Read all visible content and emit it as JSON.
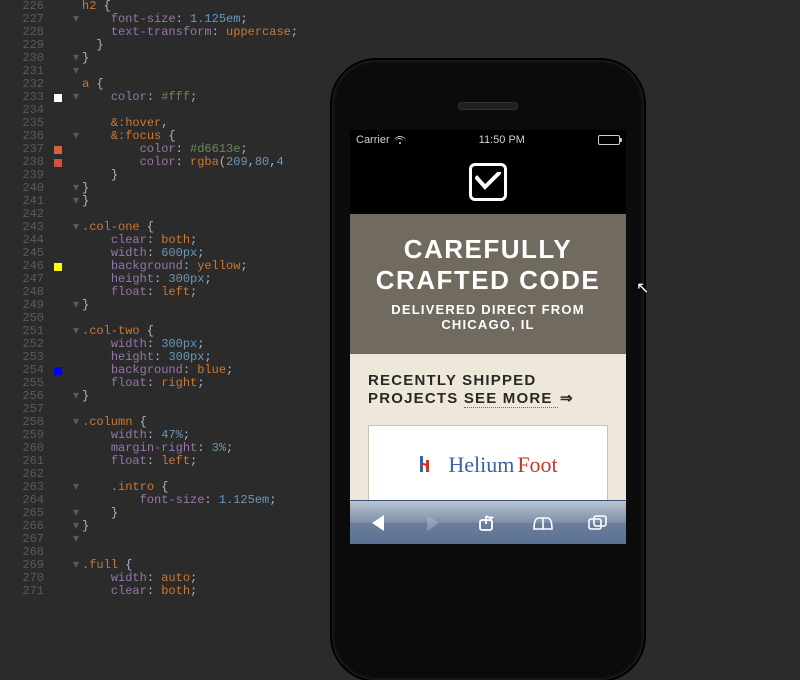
{
  "editor": {
    "first_line": 226,
    "markers": [
      {
        "line": 233,
        "color": "#ffffff"
      },
      {
        "line": 237,
        "color": "#d6613e"
      },
      {
        "line": 238,
        "color": "#d15040"
      },
      {
        "line": 246,
        "color": "#ffff00"
      },
      {
        "line": 254,
        "color": "#0000ff"
      }
    ],
    "fold_lines": [
      227,
      230,
      231,
      233,
      236,
      240,
      241,
      243,
      249,
      251,
      256,
      258,
      263,
      265,
      266,
      267,
      269
    ],
    "lines": [
      [
        {
          "t": "sel",
          "s": "h2"
        },
        {
          "t": "punc",
          "s": " {"
        }
      ],
      [
        {
          "t": "pad",
          "s": "    "
        },
        {
          "t": "prop",
          "s": "font-size"
        },
        {
          "t": "punc",
          "s": ": "
        },
        {
          "t": "val",
          "s": "1.125em"
        },
        {
          "t": "punc",
          "s": ";"
        }
      ],
      [
        {
          "t": "pad",
          "s": "    "
        },
        {
          "t": "prop",
          "s": "text-transform"
        },
        {
          "t": "punc",
          "s": ": "
        },
        {
          "t": "kw",
          "s": "uppercase"
        },
        {
          "t": "punc",
          "s": ";"
        }
      ],
      [
        {
          "t": "pad",
          "s": "  "
        },
        {
          "t": "punc",
          "s": "}"
        }
      ],
      [
        {
          "t": "punc",
          "s": "}"
        }
      ],
      [],
      [
        {
          "t": "sel",
          "s": "a"
        },
        {
          "t": "punc",
          "s": " {"
        }
      ],
      [
        {
          "t": "pad",
          "s": "    "
        },
        {
          "t": "prop",
          "s": "color"
        },
        {
          "t": "punc",
          "s": ": "
        },
        {
          "t": "hex",
          "s": "#fff"
        },
        {
          "t": "punc",
          "s": ";"
        }
      ],
      [],
      [
        {
          "t": "pad",
          "s": "    "
        },
        {
          "t": "sel",
          "s": "&:hover"
        },
        {
          "t": "punc",
          "s": ","
        }
      ],
      [
        {
          "t": "pad",
          "s": "    "
        },
        {
          "t": "sel",
          "s": "&:focus"
        },
        {
          "t": "punc",
          "s": " {"
        }
      ],
      [
        {
          "t": "pad",
          "s": "        "
        },
        {
          "t": "prop",
          "s": "color"
        },
        {
          "t": "punc",
          "s": ": "
        },
        {
          "t": "hex",
          "s": "#d6613e"
        },
        {
          "t": "punc",
          "s": ";"
        }
      ],
      [
        {
          "t": "pad",
          "s": "        "
        },
        {
          "t": "prop",
          "s": "color"
        },
        {
          "t": "punc",
          "s": ": "
        },
        {
          "t": "kw",
          "s": "rgba"
        },
        {
          "t": "punc",
          "s": "("
        },
        {
          "t": "num",
          "s": "209"
        },
        {
          "t": "punc",
          "s": ","
        },
        {
          "t": "num",
          "s": "80"
        },
        {
          "t": "punc",
          "s": ","
        },
        {
          "t": "num",
          "s": "4"
        }
      ],
      [
        {
          "t": "pad",
          "s": "    "
        },
        {
          "t": "punc",
          "s": "}"
        }
      ],
      [
        {
          "t": "punc",
          "s": "}"
        }
      ],
      [
        {
          "t": "punc",
          "s": "}"
        }
      ],
      [],
      [
        {
          "t": "sel",
          "s": ".col-one"
        },
        {
          "t": "punc",
          "s": " {"
        }
      ],
      [
        {
          "t": "pad",
          "s": "    "
        },
        {
          "t": "prop",
          "s": "clear"
        },
        {
          "t": "punc",
          "s": ": "
        },
        {
          "t": "kw",
          "s": "both"
        },
        {
          "t": "punc",
          "s": ";"
        }
      ],
      [
        {
          "t": "pad",
          "s": "    "
        },
        {
          "t": "prop",
          "s": "width"
        },
        {
          "t": "punc",
          "s": ": "
        },
        {
          "t": "val",
          "s": "600px"
        },
        {
          "t": "punc",
          "s": ";"
        }
      ],
      [
        {
          "t": "pad",
          "s": "    "
        },
        {
          "t": "prop",
          "s": "background"
        },
        {
          "t": "punc",
          "s": ": "
        },
        {
          "t": "kw",
          "s": "yellow"
        },
        {
          "t": "punc",
          "s": ";"
        }
      ],
      [
        {
          "t": "pad",
          "s": "    "
        },
        {
          "t": "prop",
          "s": "height"
        },
        {
          "t": "punc",
          "s": ": "
        },
        {
          "t": "val",
          "s": "300px"
        },
        {
          "t": "punc",
          "s": ";"
        }
      ],
      [
        {
          "t": "pad",
          "s": "    "
        },
        {
          "t": "prop",
          "s": "float"
        },
        {
          "t": "punc",
          "s": ": "
        },
        {
          "t": "kw",
          "s": "left"
        },
        {
          "t": "punc",
          "s": ";"
        }
      ],
      [
        {
          "t": "punc",
          "s": "}"
        }
      ],
      [],
      [
        {
          "t": "sel",
          "s": ".col-two"
        },
        {
          "t": "punc",
          "s": " {"
        }
      ],
      [
        {
          "t": "pad",
          "s": "    "
        },
        {
          "t": "prop",
          "s": "width"
        },
        {
          "t": "punc",
          "s": ": "
        },
        {
          "t": "val",
          "s": "300px"
        },
        {
          "t": "punc",
          "s": ";"
        }
      ],
      [
        {
          "t": "pad",
          "s": "    "
        },
        {
          "t": "prop",
          "s": "height"
        },
        {
          "t": "punc",
          "s": ": "
        },
        {
          "t": "val",
          "s": "300px"
        },
        {
          "t": "punc",
          "s": ";"
        }
      ],
      [
        {
          "t": "pad",
          "s": "    "
        },
        {
          "t": "prop",
          "s": "background"
        },
        {
          "t": "punc",
          "s": ": "
        },
        {
          "t": "kw",
          "s": "blue"
        },
        {
          "t": "punc",
          "s": ";"
        }
      ],
      [
        {
          "t": "pad",
          "s": "    "
        },
        {
          "t": "prop",
          "s": "float"
        },
        {
          "t": "punc",
          "s": ": "
        },
        {
          "t": "kw",
          "s": "right"
        },
        {
          "t": "punc",
          "s": ";"
        }
      ],
      [
        {
          "t": "punc",
          "s": "}"
        }
      ],
      [],
      [
        {
          "t": "sel",
          "s": ".column"
        },
        {
          "t": "punc",
          "s": " {"
        }
      ],
      [
        {
          "t": "pad",
          "s": "    "
        },
        {
          "t": "prop",
          "s": "width"
        },
        {
          "t": "punc",
          "s": ": "
        },
        {
          "t": "val",
          "s": "47%"
        },
        {
          "t": "punc",
          "s": ";"
        }
      ],
      [
        {
          "t": "pad",
          "s": "    "
        },
        {
          "t": "prop",
          "s": "margin-right"
        },
        {
          "t": "punc",
          "s": ": "
        },
        {
          "t": "val",
          "s": "3%"
        },
        {
          "t": "punc",
          "s": ";"
        }
      ],
      [
        {
          "t": "pad",
          "s": "    "
        },
        {
          "t": "prop",
          "s": "float"
        },
        {
          "t": "punc",
          "s": ": "
        },
        {
          "t": "kw",
          "s": "left"
        },
        {
          "t": "punc",
          "s": ";"
        }
      ],
      [],
      [
        {
          "t": "pad",
          "s": "    "
        },
        {
          "t": "sel",
          "s": ".intro"
        },
        {
          "t": "punc",
          "s": " {"
        }
      ],
      [
        {
          "t": "pad",
          "s": "        "
        },
        {
          "t": "prop",
          "s": "font-size"
        },
        {
          "t": "punc",
          "s": ": "
        },
        {
          "t": "val",
          "s": "1.125em"
        },
        {
          "t": "punc",
          "s": ";"
        }
      ],
      [
        {
          "t": "pad",
          "s": "    "
        },
        {
          "t": "punc",
          "s": "}"
        }
      ],
      [
        {
          "t": "punc",
          "s": "}"
        }
      ],
      [],
      [],
      [
        {
          "t": "sel",
          "s": ".full"
        },
        {
          "t": "punc",
          "s": " {"
        }
      ],
      [
        {
          "t": "pad",
          "s": "    "
        },
        {
          "t": "prop",
          "s": "width"
        },
        {
          "t": "punc",
          "s": ": "
        },
        {
          "t": "kw",
          "s": "auto"
        },
        {
          "t": "punc",
          "s": ";"
        }
      ],
      [
        {
          "t": "pad",
          "s": "    "
        },
        {
          "t": "prop",
          "s": "clear"
        },
        {
          "t": "punc",
          "s": ": "
        },
        {
          "t": "kw",
          "s": "both"
        },
        {
          "t": "punc",
          "s": ";"
        }
      ]
    ]
  },
  "phone": {
    "statusbar": {
      "carrier": "Carrier",
      "time": "11:50 PM"
    },
    "hero": {
      "title": "CAREFULLY CRAFTED CODE",
      "subtitle": "DELIVERED DIRECT FROM CHICAGO, IL"
    },
    "section": {
      "heading": "RECENTLY SHIPPED PROJECTS",
      "see_more": "SEE MORE",
      "arrow": "⇒"
    },
    "card": {
      "brand": "Helium Foot"
    },
    "toolbar": {
      "back": "back",
      "forward": "forward",
      "share": "share",
      "bookmarks": "bookmarks",
      "tabs": "tabs"
    }
  }
}
